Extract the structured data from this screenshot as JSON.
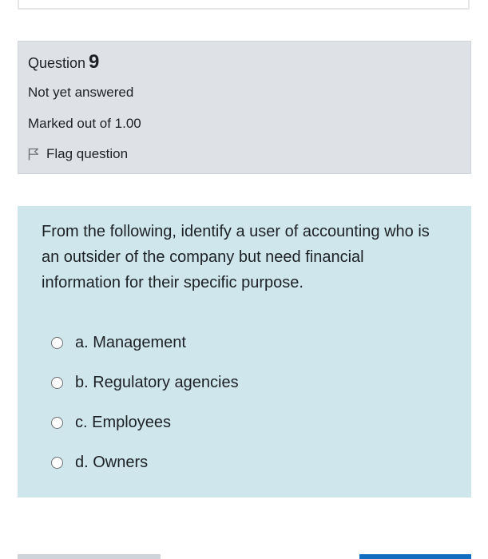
{
  "info": {
    "question_label": "Question",
    "question_number": "9",
    "state": "Not yet answered",
    "grade": "Marked out of 1.00",
    "flag_label": "Flag question"
  },
  "question": {
    "text": "From the following, identify a user of accounting who is an outsider of the company but need financial information for their specific purpose.",
    "answers": [
      {
        "label": "a. Management"
      },
      {
        "label": "b. Regulatory agencies"
      },
      {
        "label": "c. Employees"
      },
      {
        "label": "d. Owners"
      }
    ]
  },
  "colors": {
    "info_background": "#dee2e6",
    "content_background": "#cfe6ec",
    "next_button": "#0f6cbf",
    "previous_button": "#ced4da"
  }
}
